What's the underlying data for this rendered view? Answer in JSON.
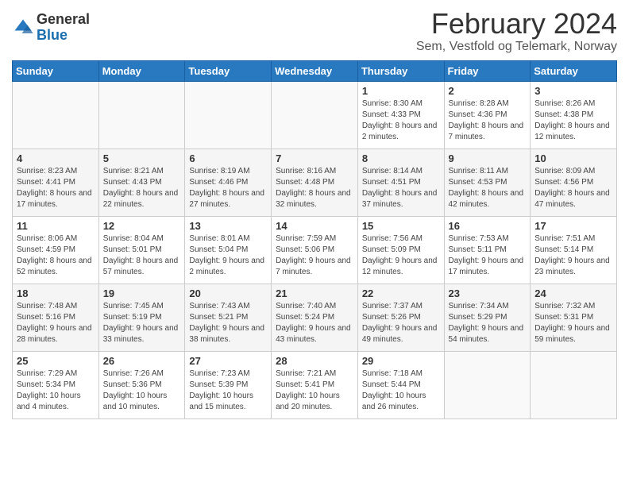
{
  "logo": {
    "general": "General",
    "blue": "Blue"
  },
  "title": "February 2024",
  "subtitle": "Sem, Vestfold og Telemark, Norway",
  "days_header": [
    "Sunday",
    "Monday",
    "Tuesday",
    "Wednesday",
    "Thursday",
    "Friday",
    "Saturday"
  ],
  "weeks": [
    [
      {
        "day": "",
        "info": ""
      },
      {
        "day": "",
        "info": ""
      },
      {
        "day": "",
        "info": ""
      },
      {
        "day": "",
        "info": ""
      },
      {
        "day": "1",
        "info": "Sunrise: 8:30 AM\nSunset: 4:33 PM\nDaylight: 8 hours\nand 2 minutes."
      },
      {
        "day": "2",
        "info": "Sunrise: 8:28 AM\nSunset: 4:36 PM\nDaylight: 8 hours\nand 7 minutes."
      },
      {
        "day": "3",
        "info": "Sunrise: 8:26 AM\nSunset: 4:38 PM\nDaylight: 8 hours\nand 12 minutes."
      }
    ],
    [
      {
        "day": "4",
        "info": "Sunrise: 8:23 AM\nSunset: 4:41 PM\nDaylight: 8 hours\nand 17 minutes."
      },
      {
        "day": "5",
        "info": "Sunrise: 8:21 AM\nSunset: 4:43 PM\nDaylight: 8 hours\nand 22 minutes."
      },
      {
        "day": "6",
        "info": "Sunrise: 8:19 AM\nSunset: 4:46 PM\nDaylight: 8 hours\nand 27 minutes."
      },
      {
        "day": "7",
        "info": "Sunrise: 8:16 AM\nSunset: 4:48 PM\nDaylight: 8 hours\nand 32 minutes."
      },
      {
        "day": "8",
        "info": "Sunrise: 8:14 AM\nSunset: 4:51 PM\nDaylight: 8 hours\nand 37 minutes."
      },
      {
        "day": "9",
        "info": "Sunrise: 8:11 AM\nSunset: 4:53 PM\nDaylight: 8 hours\nand 42 minutes."
      },
      {
        "day": "10",
        "info": "Sunrise: 8:09 AM\nSunset: 4:56 PM\nDaylight: 8 hours\nand 47 minutes."
      }
    ],
    [
      {
        "day": "11",
        "info": "Sunrise: 8:06 AM\nSunset: 4:59 PM\nDaylight: 8 hours\nand 52 minutes."
      },
      {
        "day": "12",
        "info": "Sunrise: 8:04 AM\nSunset: 5:01 PM\nDaylight: 8 hours\nand 57 minutes."
      },
      {
        "day": "13",
        "info": "Sunrise: 8:01 AM\nSunset: 5:04 PM\nDaylight: 9 hours\nand 2 minutes."
      },
      {
        "day": "14",
        "info": "Sunrise: 7:59 AM\nSunset: 5:06 PM\nDaylight: 9 hours\nand 7 minutes."
      },
      {
        "day": "15",
        "info": "Sunrise: 7:56 AM\nSunset: 5:09 PM\nDaylight: 9 hours\nand 12 minutes."
      },
      {
        "day": "16",
        "info": "Sunrise: 7:53 AM\nSunset: 5:11 PM\nDaylight: 9 hours\nand 17 minutes."
      },
      {
        "day": "17",
        "info": "Sunrise: 7:51 AM\nSunset: 5:14 PM\nDaylight: 9 hours\nand 23 minutes."
      }
    ],
    [
      {
        "day": "18",
        "info": "Sunrise: 7:48 AM\nSunset: 5:16 PM\nDaylight: 9 hours\nand 28 minutes."
      },
      {
        "day": "19",
        "info": "Sunrise: 7:45 AM\nSunset: 5:19 PM\nDaylight: 9 hours\nand 33 minutes."
      },
      {
        "day": "20",
        "info": "Sunrise: 7:43 AM\nSunset: 5:21 PM\nDaylight: 9 hours\nand 38 minutes."
      },
      {
        "day": "21",
        "info": "Sunrise: 7:40 AM\nSunset: 5:24 PM\nDaylight: 9 hours\nand 43 minutes."
      },
      {
        "day": "22",
        "info": "Sunrise: 7:37 AM\nSunset: 5:26 PM\nDaylight: 9 hours\nand 49 minutes."
      },
      {
        "day": "23",
        "info": "Sunrise: 7:34 AM\nSunset: 5:29 PM\nDaylight: 9 hours\nand 54 minutes."
      },
      {
        "day": "24",
        "info": "Sunrise: 7:32 AM\nSunset: 5:31 PM\nDaylight: 9 hours\nand 59 minutes."
      }
    ],
    [
      {
        "day": "25",
        "info": "Sunrise: 7:29 AM\nSunset: 5:34 PM\nDaylight: 10 hours\nand 4 minutes."
      },
      {
        "day": "26",
        "info": "Sunrise: 7:26 AM\nSunset: 5:36 PM\nDaylight: 10 hours\nand 10 minutes."
      },
      {
        "day": "27",
        "info": "Sunrise: 7:23 AM\nSunset: 5:39 PM\nDaylight: 10 hours\nand 15 minutes."
      },
      {
        "day": "28",
        "info": "Sunrise: 7:21 AM\nSunset: 5:41 PM\nDaylight: 10 hours\nand 20 minutes."
      },
      {
        "day": "29",
        "info": "Sunrise: 7:18 AM\nSunset: 5:44 PM\nDaylight: 10 hours\nand 26 minutes."
      },
      {
        "day": "",
        "info": ""
      },
      {
        "day": "",
        "info": ""
      }
    ]
  ]
}
